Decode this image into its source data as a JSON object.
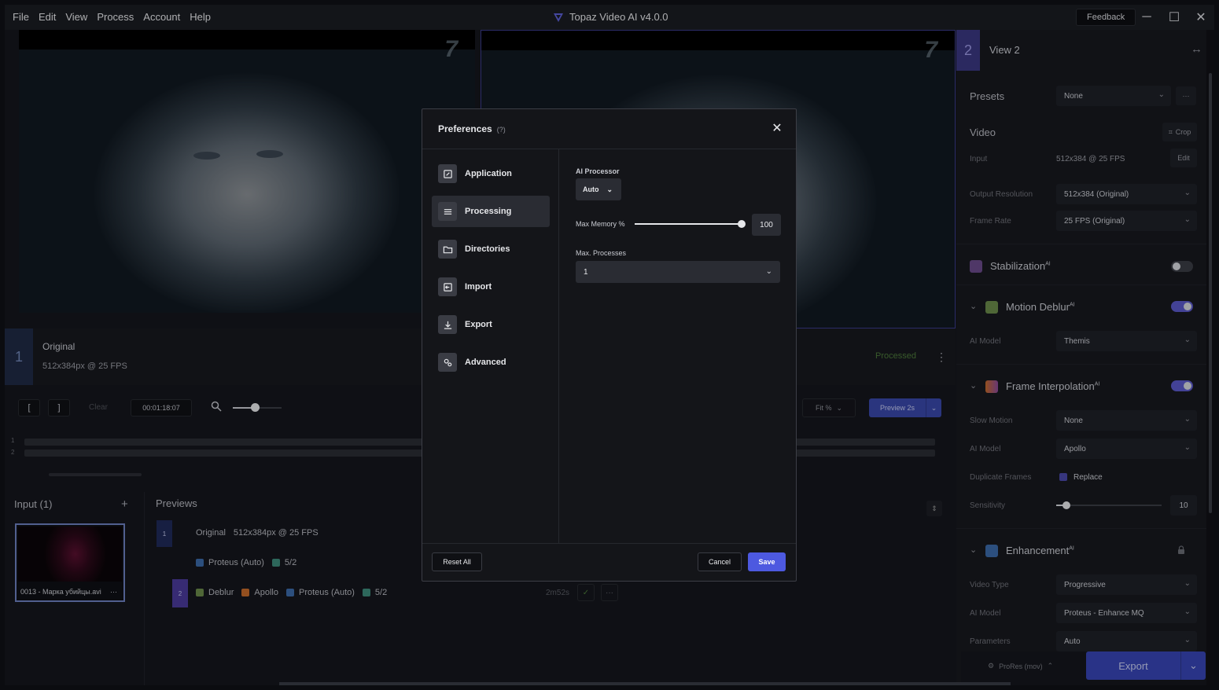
{
  "titlebar": {
    "menu": [
      "File",
      "Edit",
      "View",
      "Process",
      "Account",
      "Help"
    ],
    "app_title": "Topaz Video AI  v4.0.0",
    "feedback": "Feedback",
    "minimize": "─",
    "maximize": "☐",
    "close": "✕"
  },
  "viewer": {
    "left_label": "Original",
    "left_resolution": "512x384px @ 25 FPS",
    "view_number": "1",
    "processed_label": "Processed",
    "kebab": "⋮",
    "channel_mark": "7"
  },
  "timeline": {
    "mark_in": "[",
    "mark_out": "]",
    "clear": "Clear",
    "timecode": "00:01:18:07",
    "zoom_icon": "🔍",
    "fit": "Fit %",
    "preview_button": "Preview 2s",
    "dropdown_chevron": "⌄",
    "track1": "1",
    "track2": "2"
  },
  "input_panel": {
    "title": "Input (1)",
    "add": "+",
    "thumbnail_name": "0013 - Марка убийцы.avi",
    "thumbnail_more": "···"
  },
  "previews": {
    "title": "Previews",
    "row1_num": "1",
    "row1_original": "Original",
    "row1_res": "512x384px @ 25 FPS",
    "row1_model": "Proteus (Auto)",
    "row1_count": "5/2",
    "row2_num": "2",
    "row2_deblur": "Deblur",
    "row2_apollo": "Apollo",
    "row2_proteus": "Proteus (Auto)",
    "row2_count": "5/2",
    "row2_time": "2m52s",
    "row2_check": "✓",
    "row2_more": "···",
    "sort_icon": "⇕"
  },
  "right_panel": {
    "view_number": "2",
    "view_title": "View 2",
    "swap_icon": "↔",
    "presets_label": "Presets",
    "presets_value": "None",
    "presets_more": "···",
    "video_label": "Video",
    "crop_label": "Crop",
    "input_label": "Input",
    "input_value": "512x384 @ 25 FPS",
    "edit_label": "Edit",
    "output_res_label": "Output Resolution",
    "output_res_value": "512x384 (Original)",
    "frame_rate_label": "Frame Rate",
    "frame_rate_value": "25 FPS (Original)",
    "stabilization": "Stabilization",
    "motion_deblur": "Motion Deblur",
    "deblur_model_label": "AI Model",
    "deblur_model_value": "Themis",
    "frame_interp": "Frame Interpolation",
    "slow_motion_label": "Slow Motion",
    "slow_motion_value": "None",
    "interp_model_label": "AI Model",
    "interp_model_value": "Apollo",
    "duplicate_label": "Duplicate Frames",
    "duplicate_value": "Replace",
    "sensitivity_label": "Sensitivity",
    "sensitivity_value": "10",
    "sensitivity_fraction": 0.1,
    "enhancement": "Enhancement",
    "video_type_label": "Video Type",
    "video_type_value": "Progressive",
    "enh_model_label": "AI Model",
    "enh_model_value": "Proteus - Enhance MQ",
    "parameters_label": "Parameters",
    "parameters_value": "Auto",
    "ai_sup": "AI",
    "prores": "ProRes (mov)",
    "export": "Export"
  },
  "dialog": {
    "title": "Preferences",
    "help": "(?)",
    "close": "✕",
    "nav": [
      "Application",
      "Processing",
      "Directories",
      "Import",
      "Export",
      "Advanced"
    ],
    "active_nav": "Processing",
    "ai_processor_label": "AI Processor",
    "ai_processor_value": "Auto",
    "max_memory_label": "Max Memory %",
    "max_memory_value": "100",
    "max_memory_fraction": 1.0,
    "max_processes_label": "Max. Processes",
    "max_processes_value": "1",
    "reset_all": "Reset All",
    "cancel": "Cancel",
    "save": "Save"
  },
  "colors": {
    "accent": "#4d59e0",
    "toggle_on": "#5a59c8",
    "processed_green": "#4c7a3a"
  }
}
